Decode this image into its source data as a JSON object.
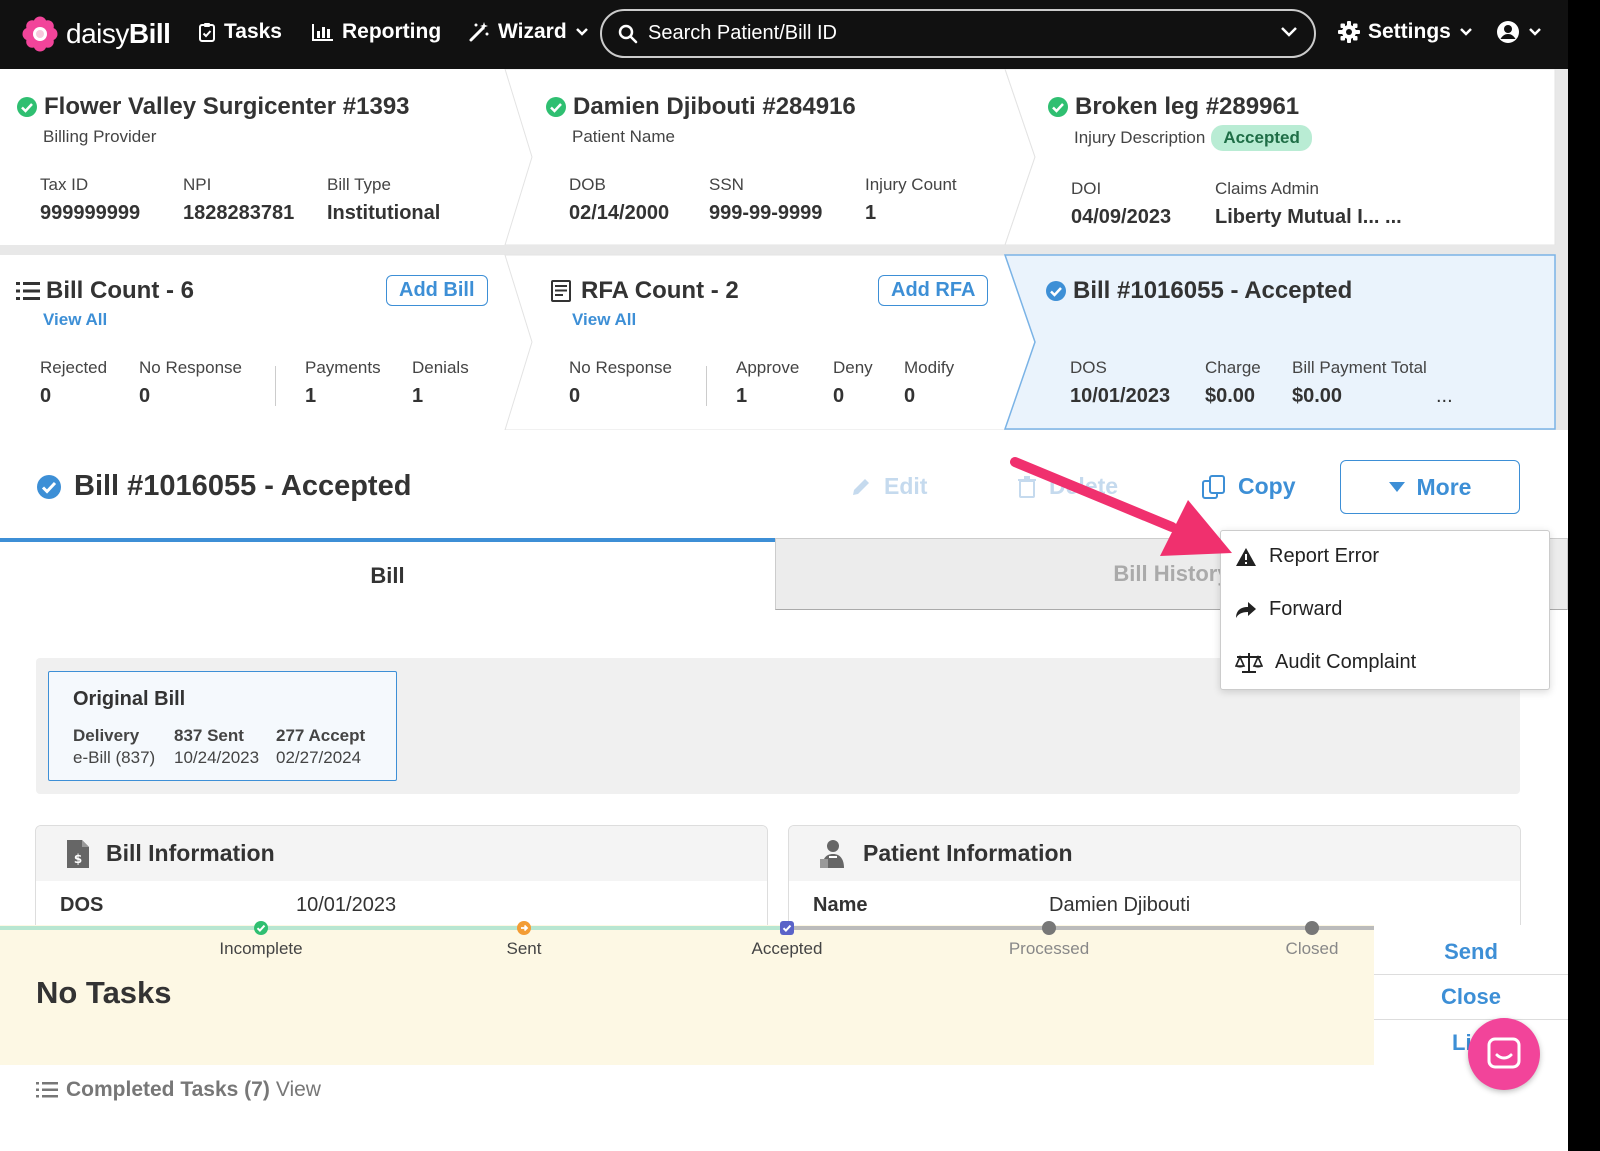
{
  "brand": {
    "name_light": "daisy",
    "name_bold": "Bill"
  },
  "nav": {
    "tasks": "Tasks",
    "reporting": "Reporting",
    "wizard": "Wizard",
    "search_placeholder": "Search Patient/Bill ID",
    "settings": "Settings"
  },
  "provider": {
    "title": "Flower Valley Surgicenter #1393",
    "subtitle": "Billing Provider",
    "fields": [
      {
        "label": "Tax ID",
        "value": "999999999"
      },
      {
        "label": "NPI",
        "value": "1828283781"
      },
      {
        "label": "Bill Type",
        "value": "Institutional"
      }
    ]
  },
  "patient": {
    "title": "Damien Djibouti #284916",
    "subtitle": "Patient Name",
    "fields": [
      {
        "label": "DOB",
        "value": "02/14/2000"
      },
      {
        "label": "SSN",
        "value": "999-99-9999"
      },
      {
        "label": "Injury Count",
        "value": "1"
      }
    ]
  },
  "injury": {
    "title": "Broken leg #289961",
    "subtitle": "Injury Description",
    "badge": "Accepted",
    "fields": [
      {
        "label": "DOI",
        "value": "04/09/2023"
      },
      {
        "label": "Claims Admin",
        "value": "Liberty Mutual I... ..."
      }
    ]
  },
  "bill_count": {
    "title": "Bill Count - 6",
    "view_all": "View All",
    "add_button": "Add Bill",
    "fields": [
      {
        "label": "Rejected",
        "value": "0"
      },
      {
        "label": "No Response",
        "value": "0"
      },
      {
        "label": "Payments",
        "value": "1"
      },
      {
        "label": "Denials",
        "value": "1"
      }
    ]
  },
  "rfa_count": {
    "title": "RFA Count - 2",
    "view_all": "View All",
    "add_button": "Add RFA",
    "fields": [
      {
        "label": "No Response",
        "value": "0"
      },
      {
        "label": "Approve",
        "value": "1"
      },
      {
        "label": "Deny",
        "value": "0"
      },
      {
        "label": "Modify",
        "value": "0"
      }
    ]
  },
  "bill_summary": {
    "title": "Bill #1016055 - Accepted",
    "fields": [
      {
        "label": "DOS",
        "value": "10/01/2023"
      },
      {
        "label": "Charge",
        "value": "$0.00"
      },
      {
        "label": "Bill Payment Total",
        "value": "$0.00"
      }
    ],
    "ellipsis": "..."
  },
  "bill_header": {
    "title": "Bill #1016055 - Accepted",
    "edit": "Edit",
    "delete": "Delete",
    "copy": "Copy",
    "more": "More"
  },
  "tabs": {
    "bill": "Bill",
    "history": "Bill History"
  },
  "more_menu": [
    "Report Error",
    "Forward",
    "Audit Complaint"
  ],
  "original_bill": {
    "title": "Original Bill",
    "columns": [
      {
        "label": "Delivery",
        "value": "e-Bill (837)"
      },
      {
        "label": "837 Sent",
        "value": "10/24/2023"
      },
      {
        "label": "277 Accept",
        "value": "02/27/2024"
      }
    ]
  },
  "bill_info": {
    "title": "Bill Information",
    "key": "DOS",
    "value": "10/01/2023"
  },
  "patient_info": {
    "title": "Patient Information",
    "key": "Name",
    "value": "Damien Djibouti"
  },
  "status_steps": [
    "Incomplete",
    "Sent",
    "Accepted",
    "Processed",
    "Closed"
  ],
  "tasks": {
    "empty": "No Tasks",
    "completed_label": "Completed Tasks (7)",
    "view": "View"
  },
  "side_actions": [
    "Send",
    "Close",
    "Li"
  ],
  "colors": {
    "accent": "#3d8fd6",
    "success": "#2fbf71",
    "annotation": "#f0306e",
    "brand_pink": "#f2449a"
  }
}
